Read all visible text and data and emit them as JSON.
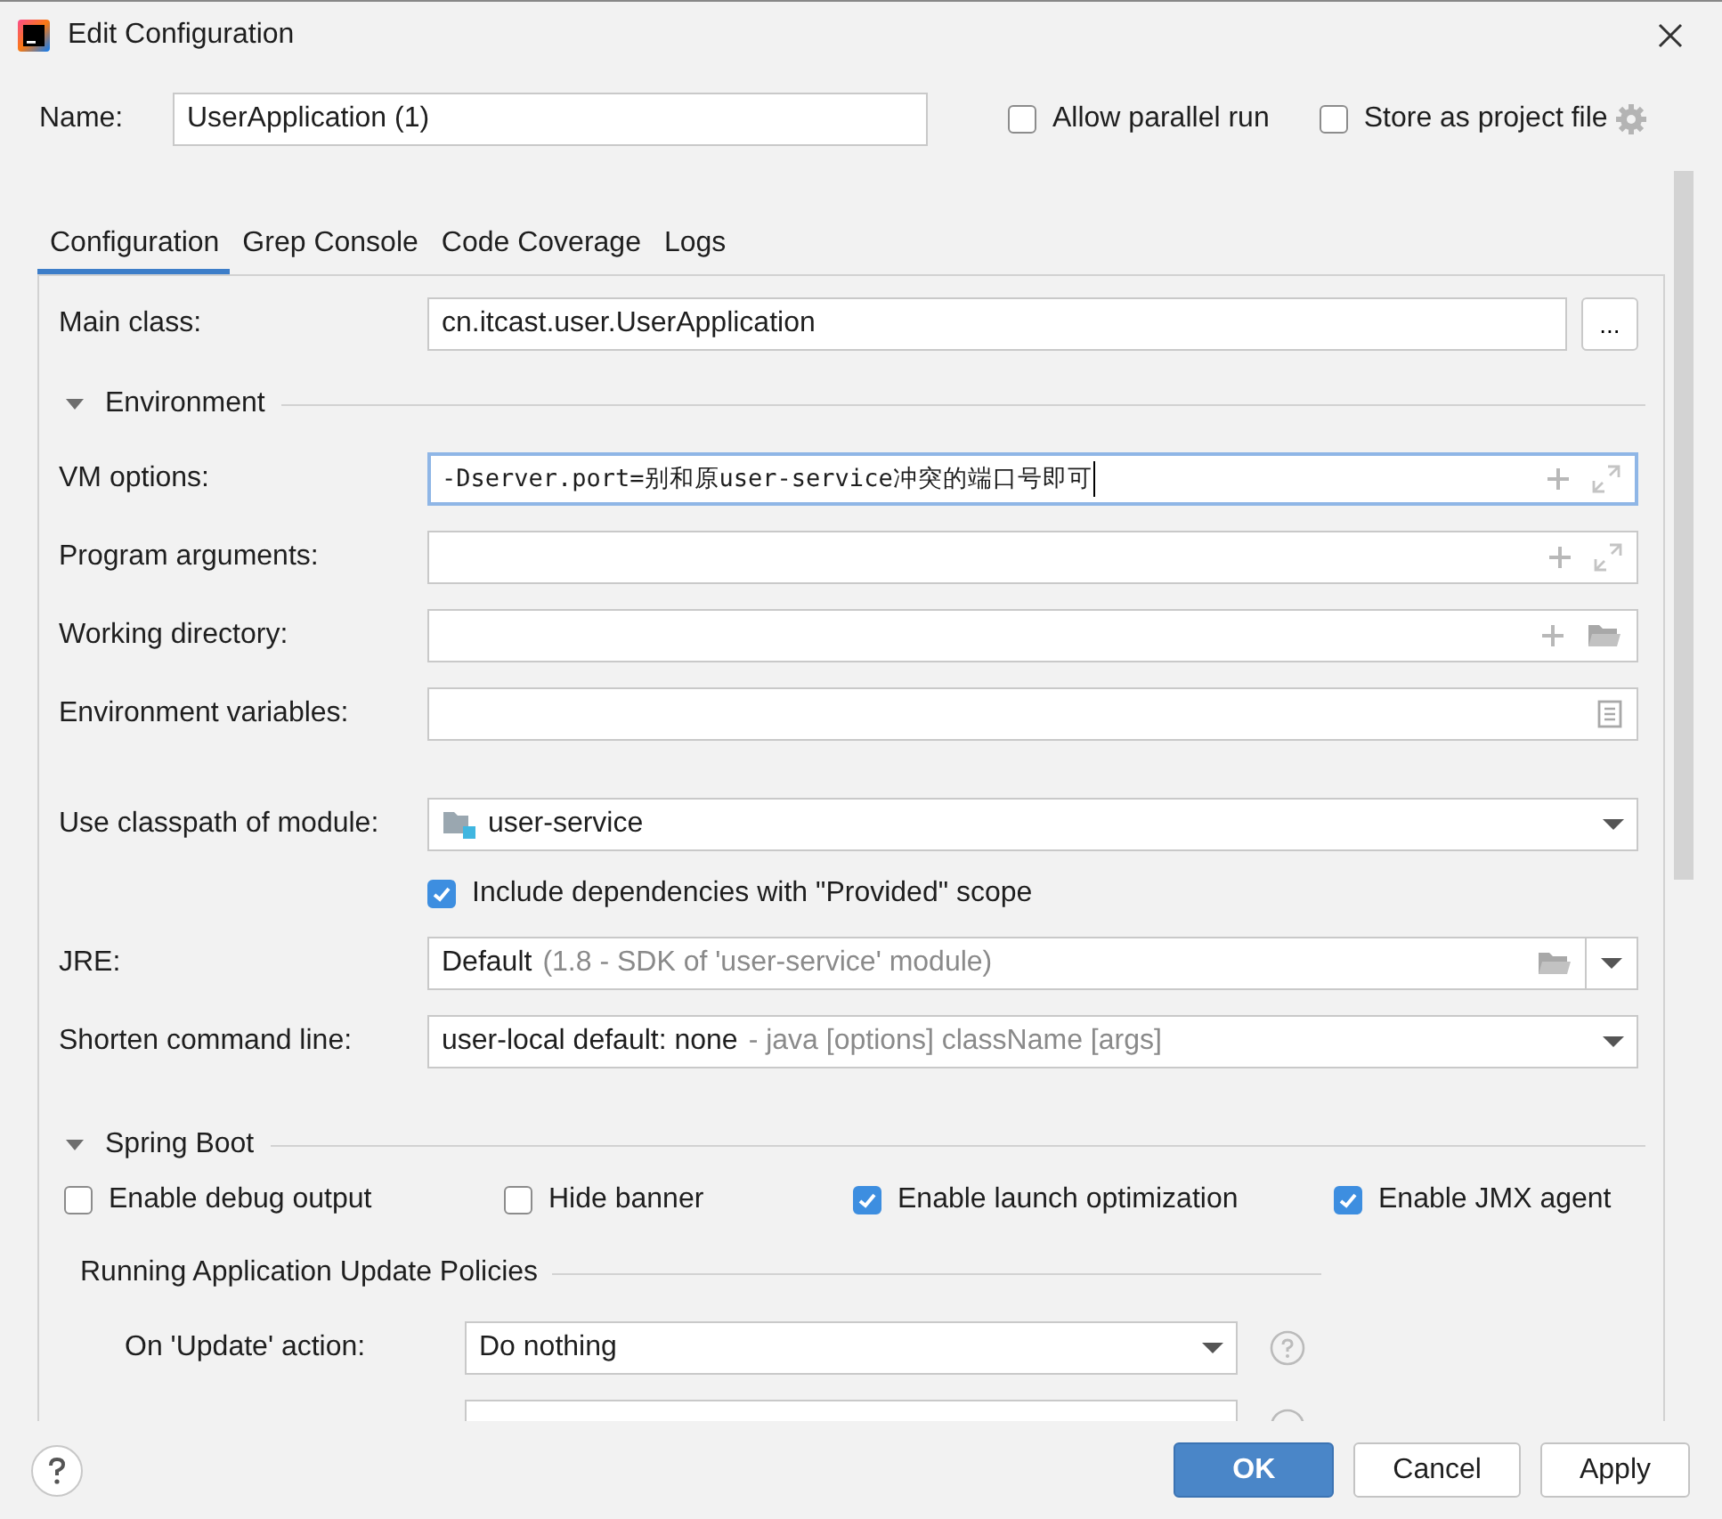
{
  "window": {
    "title": "Edit Configuration"
  },
  "name": {
    "label": "Name:",
    "value": "UserApplication (1)"
  },
  "header_options": [
    {
      "label": "Allow parallel run",
      "checked": false
    },
    {
      "label": "Store as project file",
      "checked": false
    }
  ],
  "tabs": [
    {
      "label": "Configuration",
      "selected": true
    },
    {
      "label": "Grep Console",
      "selected": false
    },
    {
      "label": "Code Coverage",
      "selected": false
    },
    {
      "label": "Logs",
      "selected": false
    }
  ],
  "main_class": {
    "label": "Main class:",
    "value": "cn.itcast.user.UserApplication",
    "button": "..."
  },
  "environment": {
    "title": "Environment",
    "expanded": true,
    "fields": [
      {
        "label": "VM options:",
        "value": "-Dserver.port=别和原user-service冲突的端口号即可",
        "kind": "expandable",
        "focused": true
      },
      {
        "label": "Program arguments:",
        "kind": "expandable",
        "focused": false
      },
      {
        "label": "Working directory:",
        "kind": "directory",
        "focused": false
      },
      {
        "label": "Environment variables:",
        "kind": "variables",
        "focused": false
      }
    ]
  },
  "classpath": {
    "label": "Use classpath of module:",
    "value": "user-service"
  },
  "include_provided": {
    "label": "Include dependencies with \"Provided\" scope",
    "checked": true
  },
  "jre": {
    "label": "JRE:",
    "value": "Default",
    "hint": "(1.8 - SDK of 'user-service' module)"
  },
  "shorten": {
    "label": "Shorten command line:",
    "value": "user-local default: none",
    "hint": "- java [options] className [args]"
  },
  "spring_boot": {
    "title": "Spring Boot",
    "expanded": true,
    "options": [
      {
        "label": "Enable debug output",
        "checked": false
      },
      {
        "label": "Hide banner",
        "checked": false
      },
      {
        "label": "Enable launch optimization",
        "checked": true
      },
      {
        "label": "Enable JMX agent",
        "checked": true
      }
    ],
    "policies": {
      "title": "Running Application Update Policies",
      "rows": [
        {
          "label": "On 'Update' action:",
          "value": "Do nothing"
        }
      ]
    }
  },
  "buttons": [
    {
      "label": "OK",
      "primary": true
    },
    {
      "label": "Cancel",
      "primary": false
    },
    {
      "label": "Apply",
      "primary": false
    }
  ]
}
